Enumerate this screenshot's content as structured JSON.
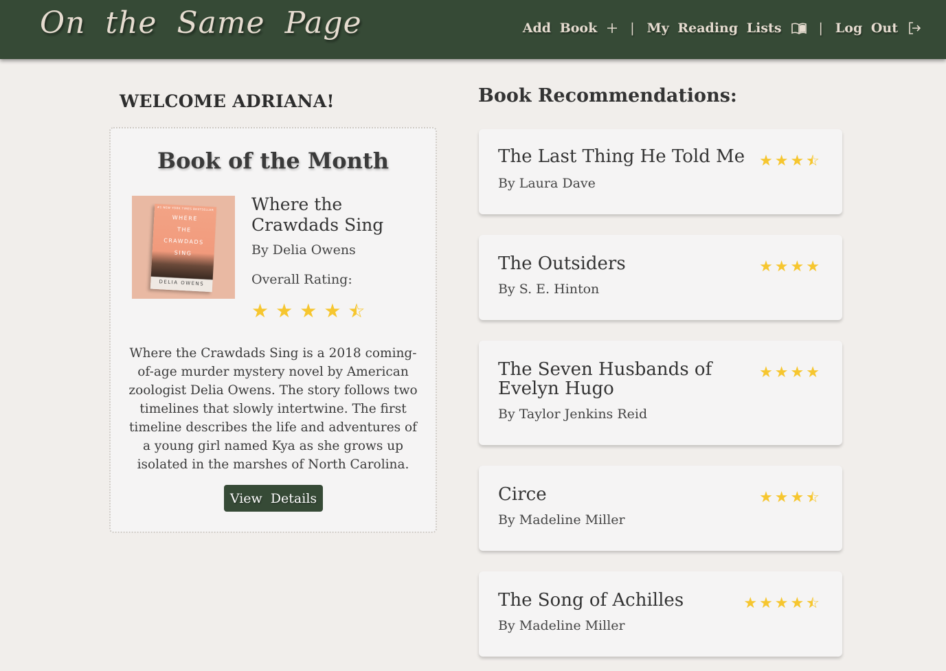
{
  "header": {
    "logo": "On the Same Page",
    "nav": [
      {
        "label": "Add Book",
        "icon": "plus-icon"
      },
      {
        "label": "My Reading Lists",
        "icon": "open-book-icon"
      },
      {
        "label": "Log Out",
        "icon": "log-out-icon"
      }
    ],
    "separator": "|"
  },
  "welcome": "WELCOME ADRIANA!",
  "book_of_month": {
    "heading": "Book of the Month",
    "cover": {
      "banner": "#1 NEW YORK TIMES BESTSELLER",
      "title_lines": [
        "WHERE",
        "THE",
        "CRAWDADS",
        "SING"
      ],
      "author": "DELIA OWENS"
    },
    "title": "Where the Crawdads Sing",
    "author": "By Delia Owens",
    "rating_label": "Overall Rating:",
    "rating": 4.5,
    "description": "Where the Crawdads Sing is a 2018 coming-of-age murder mystery novel by American zoologist Delia Owens. The story follows two timelines that slowly intertwine. The first timeline describes the life and adventures of a young girl named Kya as she grows up isolated in the marshes of North Carolina.",
    "button": "View Details"
  },
  "recommendations": {
    "heading": "Book Recommendations:",
    "items": [
      {
        "title": "The Last Thing He Told Me",
        "author": "By Laura Dave",
        "rating": 3.5
      },
      {
        "title": "The Outsiders",
        "author": "By S. E. Hinton",
        "rating": 4
      },
      {
        "title": "The Seven Husbands of Evelyn Hugo",
        "author": "By Taylor Jenkins Reid",
        "rating": 4
      },
      {
        "title": "Circe",
        "author": "By Madeline Miller",
        "rating": 3.5
      },
      {
        "title": "The Song of Achilles",
        "author": "By Madeline Miller",
        "rating": 4.5
      }
    ]
  },
  "colors": {
    "header": "#364a36",
    "background": "#f1eeeb",
    "star": "#f6c62f",
    "logo": "#e6dcd0"
  }
}
